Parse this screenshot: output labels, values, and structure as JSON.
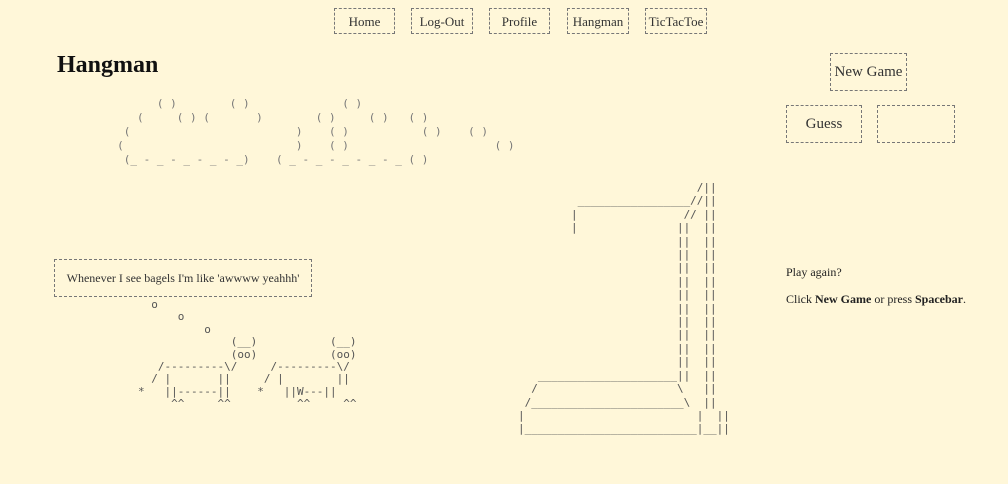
{
  "nav": {
    "items": [
      {
        "label": "Home",
        "name": "nav-home"
      },
      {
        "label": "Log-Out",
        "name": "nav-logout"
      },
      {
        "label": "Profile",
        "name": "nav-profile"
      },
      {
        "label": "Hangman",
        "name": "nav-hangman"
      },
      {
        "label": "TicTacToe",
        "name": "nav-tictactoe"
      }
    ]
  },
  "page": {
    "title": "Hangman"
  },
  "art": {
    "clouds": "           ( )        ( )              ( )\n        (     ( ) (       )        ( )     ( )   ( )\n      (                         )    ( )           ( )    ( )\n     (                          )    ( )                      ( )\n      (_ - _ - _ - _ - _)    ( _ - _ - _ - _ - _ ( )",
    "thought": "Whenever I see bagels I'm like 'awwww yeahhh'",
    "cows": "  o\n      o\n          o\n              (__)           (__)\n              (oo)           (oo)\n   /---------\\/     /---------\\/\n  / |       ||     / |        ||\n*   ||------||    *   ||W---||\n     ^^     ^^          ^^     ^^",
    "gallows": "                           /||\n         _________________//||\n        |                // ||\n        |               ||  ||\n                        ||  ||\n                        ||  ||\n                        ||  ||\n                        ||  ||\n                        ||  ||\n                        ||  ||\n                        ||  ||\n                        ||  ||\n                        ||  ||\n                        ||  ||\n   _____________________||  ||\n  /                     \\   ||\n /_______________________\\  ||\n|                          |  ||\n|__________________________|__||"
  },
  "controls": {
    "new_game": "New Game",
    "guess": "Guess",
    "guess_value": ""
  },
  "status": {
    "play_again": "Play again?",
    "click": "Click ",
    "new_game": "New Game",
    "or_press": " or press ",
    "spacebar": "Spacebar",
    "period": "."
  }
}
